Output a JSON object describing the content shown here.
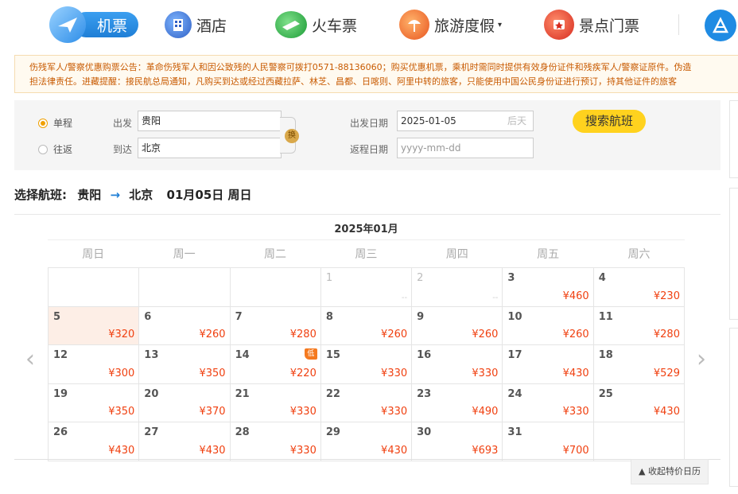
{
  "nav": {
    "items": [
      {
        "label": "机票",
        "icon": "plane-icon"
      },
      {
        "label": "酒店",
        "icon": "hotel-icon"
      },
      {
        "label": "火车票",
        "icon": "train-icon"
      },
      {
        "label": "旅游度假",
        "icon": "tour-icon"
      },
      {
        "label": "景点门票",
        "icon": "scenic-icon"
      }
    ],
    "extra_icon": "brand-icon"
  },
  "notice": {
    "line1": "伤残军人/警察优惠购票公告：革命伤残军人和因公致残的人民警察可拨打0571-88136060；购买优惠机票，乘机时需同时提供有效身份证件和残疾军人/警察证原件。伪造",
    "line2": "担法律责任。进藏提醒：接民航总局通知，凡购买到达或经过西藏拉萨、林芝、昌都、日喀则、阿里中转的旅客，只能使用中国公民身份证进行预订，持其他证件的旅客"
  },
  "search": {
    "trip_one_way": "单程",
    "trip_round": "往返",
    "from_label": "出发",
    "to_label": "到达",
    "from_value": "贵阳",
    "to_value": "北京",
    "swap_label": "换",
    "depart_label": "出发日期",
    "return_label": "返程日期",
    "depart_value": "2025-01-05",
    "depart_hint": "后天",
    "return_placeholder": "yyyy-mm-dd",
    "search_button": "搜索航班"
  },
  "heading": {
    "prefix": "选择航班:",
    "from": "贵阳",
    "arrow": "→",
    "to": "北京",
    "date": "01月05日 周日"
  },
  "calendar": {
    "month": "2025年01月",
    "weekdays": [
      "周日",
      "周一",
      "周二",
      "周三",
      "周四",
      "周五",
      "周六"
    ],
    "low_badge": "低",
    "nav_prev": "‹",
    "nav_next": "›",
    "collapse_label": "▲ 收起特价日历",
    "cells": [
      {
        "day": "",
        "price": ""
      },
      {
        "day": "",
        "price": ""
      },
      {
        "day": "",
        "price": ""
      },
      {
        "day": "1",
        "price": "--",
        "past": true
      },
      {
        "day": "2",
        "price": "--",
        "past": true
      },
      {
        "day": "3",
        "price": "¥460"
      },
      {
        "day": "4",
        "price": "¥230"
      },
      {
        "day": "5",
        "price": "¥320",
        "selected": true
      },
      {
        "day": "6",
        "price": "¥260"
      },
      {
        "day": "7",
        "price": "¥280"
      },
      {
        "day": "8",
        "price": "¥260"
      },
      {
        "day": "9",
        "price": "¥260"
      },
      {
        "day": "10",
        "price": "¥260"
      },
      {
        "day": "11",
        "price": "¥280"
      },
      {
        "day": "12",
        "price": "¥300"
      },
      {
        "day": "13",
        "price": "¥350"
      },
      {
        "day": "14",
        "price": "¥220",
        "low": true
      },
      {
        "day": "15",
        "price": "¥330"
      },
      {
        "day": "16",
        "price": "¥330"
      },
      {
        "day": "17",
        "price": "¥430"
      },
      {
        "day": "18",
        "price": "¥529"
      },
      {
        "day": "19",
        "price": "¥350"
      },
      {
        "day": "20",
        "price": "¥370"
      },
      {
        "day": "21",
        "price": "¥330"
      },
      {
        "day": "22",
        "price": "¥330"
      },
      {
        "day": "23",
        "price": "¥490"
      },
      {
        "day": "24",
        "price": "¥330"
      },
      {
        "day": "25",
        "price": "¥430"
      },
      {
        "day": "26",
        "price": "¥430"
      },
      {
        "day": "27",
        "price": "¥430"
      },
      {
        "day": "28",
        "price": "¥330"
      },
      {
        "day": "29",
        "price": "¥430"
      },
      {
        "day": "30",
        "price": "¥693"
      },
      {
        "day": "31",
        "price": "¥700"
      },
      {
        "day": "",
        "price": ""
      }
    ]
  },
  "colors": {
    "accent_blue": "#1f7fd6",
    "price_red": "#f04010",
    "search_yellow": "#ffd21e",
    "notice_orange": "#c85a00",
    "selected_cell": "#fdeee6"
  }
}
